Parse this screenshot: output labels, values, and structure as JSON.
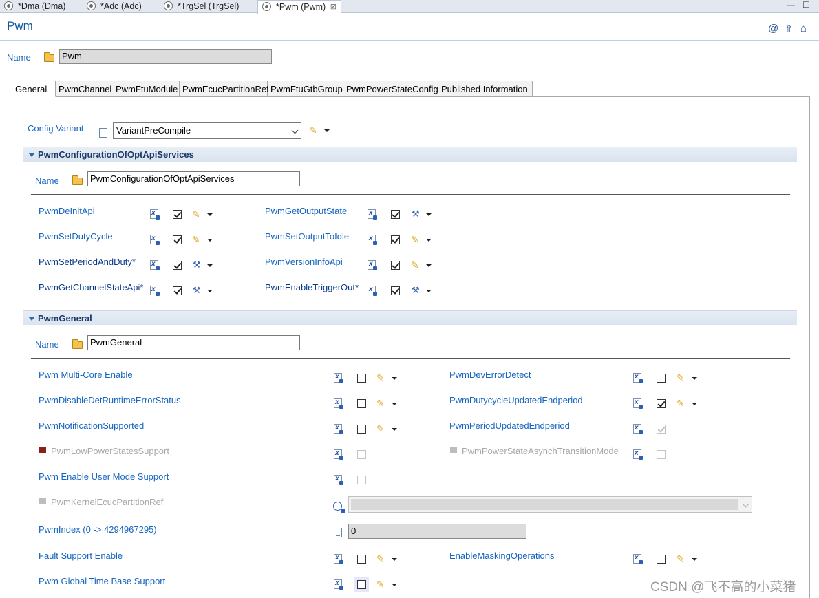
{
  "editor_tabs": [
    {
      "label": "*Dma (Dma)"
    },
    {
      "label": "*Adc (Adc)"
    },
    {
      "label": "*TrgSel (TrgSel)"
    },
    {
      "label": "*Pwm (Pwm)",
      "close": "⊠"
    }
  ],
  "window_controls": {
    "minimize": "—",
    "maximize": "☐"
  },
  "header": {
    "title": "Pwm",
    "icons": [
      "at-icon",
      "up-arrow-icon",
      "home-icon"
    ],
    "at_glyph": "@",
    "up_glyph": "⇧",
    "home_glyph": "⌂"
  },
  "name_row": {
    "label": "Name",
    "value": "Pwm"
  },
  "tabs": [
    {
      "label": "General"
    },
    {
      "label": "PwmChannel"
    },
    {
      "label": "PwmFtuModule"
    },
    {
      "label": "PwmEcucPartitionRef"
    },
    {
      "label": "PwmFtuGtbGroup"
    },
    {
      "label": "PwmPowerStateConfig"
    },
    {
      "label": "Published Information"
    }
  ],
  "config_variant": {
    "label": "Config Variant",
    "value": "VariantPreCompile"
  },
  "sections": {
    "opt_api": {
      "title": "PwmConfigurationOfOptApiServices",
      "name_label": "Name",
      "name_value": "PwmConfigurationOfOptApiServices",
      "params": [
        {
          "label": "PwmDeInitApi",
          "checked": true,
          "action": "pencil"
        },
        {
          "label": "PwmGetOutputState",
          "checked": true,
          "action": "wrench"
        },
        {
          "label": "PwmSetDutyCycle",
          "checked": true,
          "action": "pencil"
        },
        {
          "label": "PwmSetOutputToIdle",
          "checked": true,
          "action": "pencil"
        },
        {
          "label": "PwmSetPeriodAndDuty*",
          "checked": true,
          "action": "wrench"
        },
        {
          "label": "PwmVersionInfoApi",
          "checked": true,
          "action": "pencil"
        },
        {
          "label": "PwmGetChannelStateApi*",
          "checked": true,
          "action": "wrench"
        },
        {
          "label": "PwmEnableTriggerOut*",
          "checked": true,
          "action": "wrench"
        }
      ]
    },
    "general": {
      "title": "PwmGeneral",
      "name_label": "Name",
      "name_value": "PwmGeneral",
      "params": [
        {
          "label": "Pwm Multi-Core Enable",
          "checked": false,
          "action": "pencil"
        },
        {
          "label": "PwmDevErrorDetect",
          "checked": false,
          "action": "pencil"
        },
        {
          "label": "PwmDisableDetRuntimeErrorStatus",
          "checked": false,
          "action": "pencil"
        },
        {
          "label": "PwmDutycycleUpdatedEndperiod",
          "checked": true,
          "action": "pencil"
        },
        {
          "label": "PwmNotificationSupported",
          "checked": false,
          "action": "pencil"
        },
        {
          "label": "PwmPeriodUpdatedEndperiod",
          "checked": true,
          "disabled": true
        },
        {
          "label": "PwmLowPowerStatesSupport",
          "checked": false,
          "disabled": true,
          "marker": "red"
        },
        {
          "label": "PwmPowerStateAsynchTransitionMode",
          "checked": false,
          "disabled": true,
          "marker": "gray"
        },
        {
          "label": "Pwm Enable User Mode Support",
          "checked": false,
          "disabled": true
        },
        {
          "label": "PwmKernelEcucPartitionRef",
          "disabled": true,
          "marker": "gray",
          "type": "reference",
          "value": ""
        },
        {
          "label": "PwmIndex (0 -> 4294967295)",
          "type": "integer",
          "value": "0"
        },
        {
          "label": "Fault Support Enable",
          "checked": false,
          "action": "pencil"
        },
        {
          "label": "EnableMaskingOperations",
          "checked": false,
          "action": "pencil"
        },
        {
          "label": "Pwm Global Time Base Support",
          "checked": false,
          "action": "pencil",
          "focused": true
        }
      ]
    }
  },
  "glyphs": {
    "pencil": "✎",
    "wrench": "⚒"
  },
  "watermark": "CSDN @飞不高的小菜猪"
}
